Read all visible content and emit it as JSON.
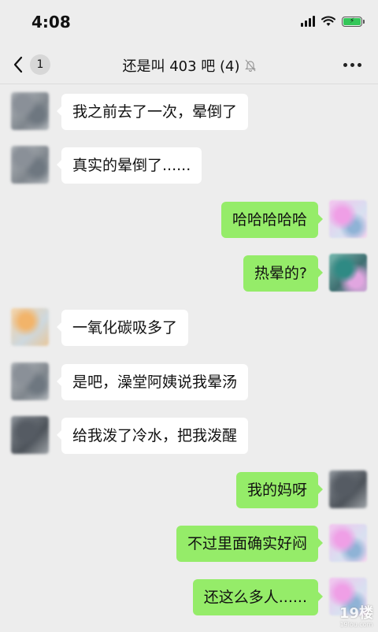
{
  "status_bar": {
    "time": "4:08"
  },
  "header": {
    "unread_count": "1",
    "title": "还是叫 403 吧 (4)"
  },
  "messages": [
    {
      "side": "in",
      "text": "我之前去了一次，晕倒了"
    },
    {
      "side": "in",
      "text": "真实的晕倒了......"
    },
    {
      "side": "out",
      "text": "哈哈哈哈哈"
    },
    {
      "side": "out",
      "text": "热晕的?"
    },
    {
      "side": "in",
      "text": "一氧化碳吸多了"
    },
    {
      "side": "in",
      "text": "是吧，澡堂阿姨说我晕汤"
    },
    {
      "side": "in",
      "text": "给我泼了冷水，把我泼醒"
    },
    {
      "side": "out",
      "text": "我的妈呀"
    },
    {
      "side": "out",
      "text": "不过里面确实好闷"
    },
    {
      "side": "out",
      "text": "还这么多人......"
    }
  ],
  "watermark": {
    "main": "19楼",
    "sub": "19lou.com"
  },
  "colors": {
    "background": "#ededed",
    "incoming_bubble": "#ffffff",
    "outgoing_bubble": "#95ec69",
    "battery_fill": "#34c759"
  },
  "icons": [
    "back-chevron-icon",
    "mute-bell-icon",
    "more-dots-icon",
    "signal-icon",
    "wifi-icon",
    "battery-icon"
  ]
}
